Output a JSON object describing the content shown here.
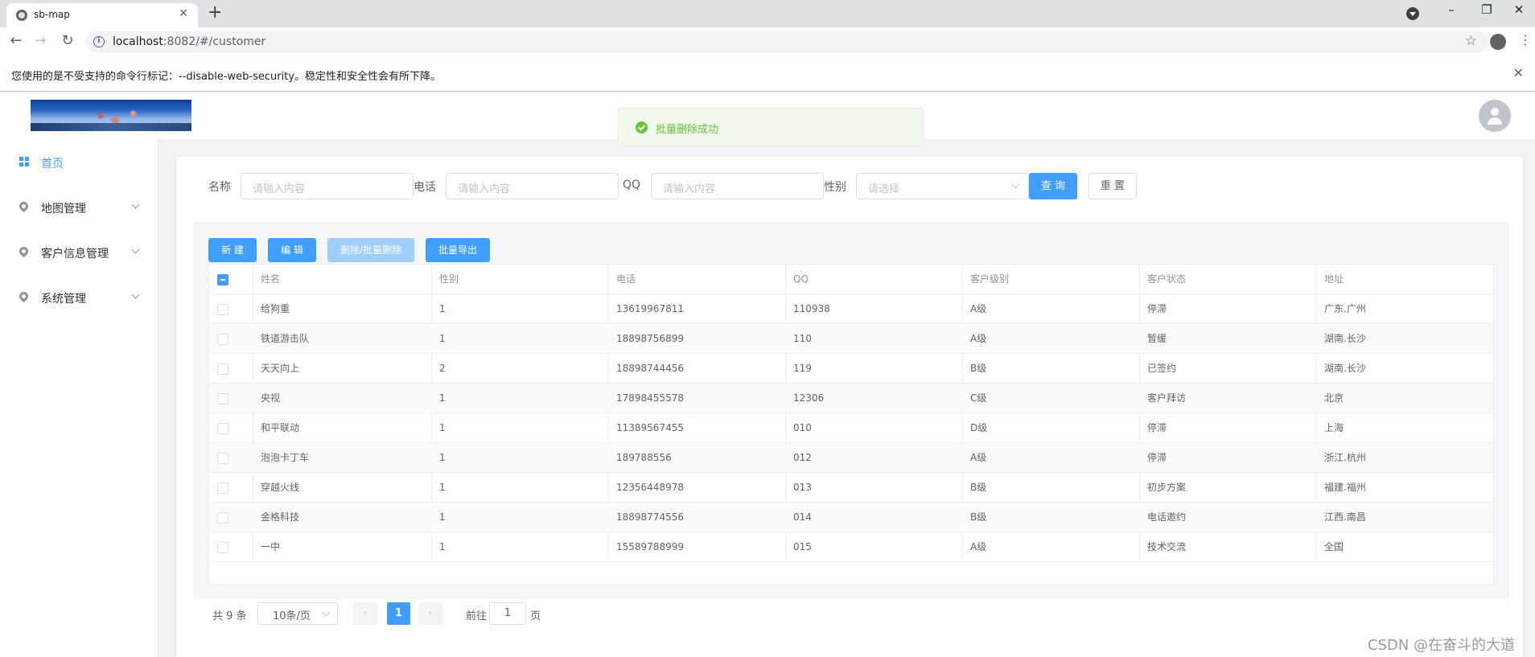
{
  "browser": {
    "tab_title": "sb-map",
    "tab_close": "✕",
    "new_tab": "+",
    "url_host": "localhost",
    "url_rest": ":8082/#/customer",
    "warning": "您使用的是不受支持的命令行标记：--disable-web-security。稳定性和安全性会有所下降。",
    "warning_close": "✕",
    "window_controls": [
      "–",
      "❐",
      "✕"
    ],
    "nav": [
      "←",
      "→",
      "↻"
    ]
  },
  "toast": {
    "message": "批量删除成功",
    "color": "#67c23a"
  },
  "sidebar": {
    "items": [
      {
        "label": "首页",
        "icon": "grid-icon",
        "active": true
      },
      {
        "label": "地图管理",
        "icon": "location-icon",
        "active": false
      },
      {
        "label": "客户信息管理",
        "icon": "location-icon",
        "active": false
      },
      {
        "label": "系统管理",
        "icon": "location-icon",
        "active": false
      }
    ]
  },
  "search": {
    "name_label": "名称",
    "name_placeholder": "请输入内容",
    "phone_label": "电话",
    "phone_placeholder": "请输入内容",
    "qq_label": "QQ",
    "qq_placeholder": "请输入内容",
    "gender_label": "性别",
    "gender_placeholder": "请选择",
    "query_button": "查 询",
    "reset_button": "重 置"
  },
  "toolbar": {
    "new": "新 建",
    "edit": "编 辑",
    "delete": "删除/批量删除",
    "export": "批量导出"
  },
  "table": {
    "headers": [
      "姓名",
      "性别",
      "电话",
      "QQ",
      "客户级别",
      "客户状态",
      "地址"
    ],
    "rows": [
      [
        "给狗重",
        "1",
        "13619967811",
        "110938",
        "A级",
        "停滞",
        "广东.广州"
      ],
      [
        "铁道游击队",
        "1",
        "18898756899",
        "110",
        "A级",
        "暂缓",
        "湖南.长沙"
      ],
      [
        "天天向上",
        "2",
        "18898744456",
        "119",
        "B级",
        "已签约",
        "湖南.长沙"
      ],
      [
        "央视",
        "1",
        "17898455578",
        "12306",
        "C级",
        "客户拜访",
        "北京"
      ],
      [
        "和平联动",
        "1",
        "11389567455",
        "010",
        "D级",
        "停滞",
        "上海"
      ],
      [
        "泡泡卡丁车",
        "1",
        "189788556",
        "012",
        "A级",
        "停滞",
        "浙江.杭州"
      ],
      [
        "穿越火线",
        "1",
        "12356448978",
        "013",
        "B级",
        "初步方案",
        "福建.福州"
      ],
      [
        "金格科技",
        "1",
        "18898774556",
        "014",
        "B级",
        "电话邀约",
        "江西.南昌"
      ],
      [
        "一中",
        "1",
        "15589788999",
        "015",
        "A级",
        "技术交流",
        "全国"
      ]
    ]
  },
  "pagination": {
    "total": "共 9 条",
    "page_size": "10条/页",
    "prev": "‹",
    "next": "›",
    "current": "1",
    "goto_prefix": "前往",
    "goto_value": "1",
    "goto_suffix": "页"
  },
  "watermark": "CSDN @在奋斗的大道",
  "colors": {
    "primary": "#409eff",
    "success": "#67c23a",
    "disabled": "#a0cfff"
  }
}
